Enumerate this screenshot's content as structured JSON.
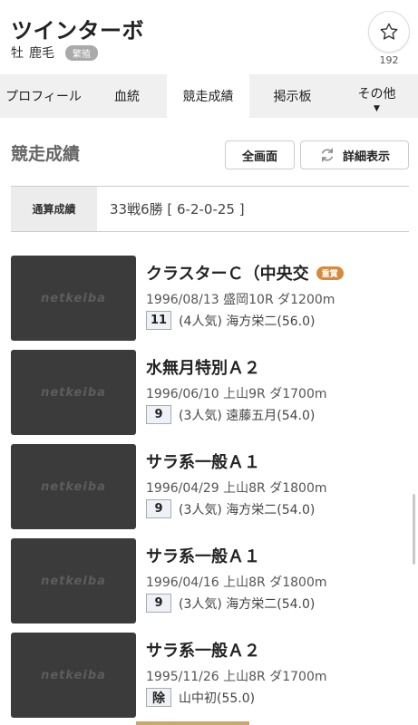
{
  "horse": {
    "name": "ツインターボ",
    "sex": "牡",
    "coat": "鹿毛",
    "status_badge": "繁殖"
  },
  "favorite": {
    "icon": "star-outline-icon",
    "count": "192"
  },
  "tabs": [
    {
      "label": "プロフィール",
      "active": false
    },
    {
      "label": "血統",
      "active": false
    },
    {
      "label": "競走成績",
      "active": true
    },
    {
      "label": "掲示板",
      "active": false
    },
    {
      "label": "その他",
      "active": false,
      "caret": "▼"
    }
  ],
  "section": {
    "title": "競走成績",
    "fullscreen_label": "全画面",
    "detail_label": "詳細表示"
  },
  "summary": {
    "label": "通算成績",
    "value": "33戦6勝 [ 6-2-0-25 ]"
  },
  "thumbnail_text": "netkeiba",
  "races": [
    {
      "name": "クラスターＣ（中央交",
      "grade_badge": "重賞",
      "info": "1996/08/13 盛岡10R ダ1200m",
      "rank": "11",
      "detail": "(4人気) 海方栄二(56.0)"
    },
    {
      "name": "水無月特別Ａ２",
      "grade_badge": "",
      "info": "1996/06/10 上山9R ダ1700m",
      "rank": "9",
      "detail": "(3人気) 遠藤五月(54.0)"
    },
    {
      "name": "サラ系一般Ａ１",
      "grade_badge": "",
      "info": "1996/04/29 上山8R ダ1800m",
      "rank": "9",
      "detail": "(3人気) 海方栄二(54.0)"
    },
    {
      "name": "サラ系一般Ａ１",
      "grade_badge": "",
      "info": "1996/04/16 上山8R ダ1800m",
      "rank": "9",
      "detail": "(3人気) 海方栄二(54.0)"
    },
    {
      "name": "サラ系一般Ａ２",
      "grade_badge": "",
      "info": "1995/11/26 上山8R ダ1700m",
      "rank": "除",
      "detail": "山中初(55.0)"
    }
  ],
  "colors": {
    "tab_bg": "#f0f0f0",
    "thumb_bg": "#3b3b3b",
    "grade_badge": "#d9893a",
    "status_badge": "#aaaaaa"
  }
}
